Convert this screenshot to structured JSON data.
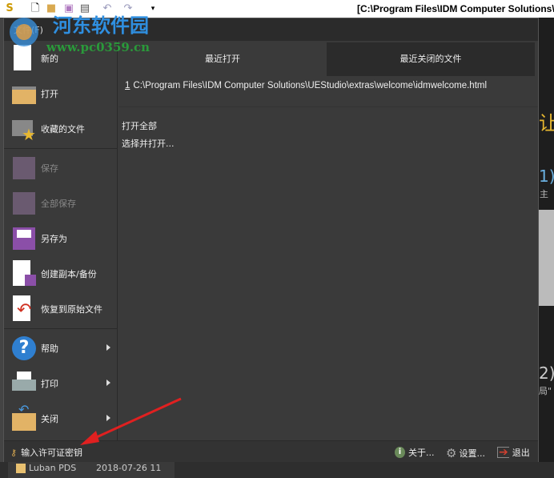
{
  "titlebar": {
    "title": "[C:\\Program Files\\IDM Computer Solutions\\U"
  },
  "menu": {
    "file_tab": "文件(F)",
    "sidebar": [
      {
        "label": "新的",
        "icon": "new-file-icon"
      },
      {
        "label": "打开",
        "icon": "open-folder-icon"
      },
      {
        "label": "收藏的文件",
        "icon": "favorites-icon"
      },
      {
        "label": "保存",
        "icon": "save-icon",
        "disabled": true
      },
      {
        "label": "全部保存",
        "icon": "save-all-icon",
        "disabled": true
      },
      {
        "label": "另存为",
        "icon": "save-as-icon"
      },
      {
        "label": "创建副本/备份",
        "icon": "backup-icon"
      },
      {
        "label": "恢复到原始文件",
        "icon": "revert-icon"
      },
      {
        "label": "帮助",
        "icon": "help-icon"
      },
      {
        "label": "打印",
        "icon": "print-icon"
      },
      {
        "label": "关闭",
        "icon": "close-folder-icon"
      }
    ],
    "tabs": [
      "最近打开",
      "最近关闭的文件"
    ],
    "recent_files": [
      {
        "num": "1",
        "path": "C:\\Program Files\\IDM Computer Solutions\\UEStudio\\extras\\welcome\\idmwelcome.html"
      }
    ],
    "open_all": "打开全部",
    "select_open": "选择并打开...",
    "bottom": {
      "license": "输入许可证密钥",
      "about": "关于...",
      "settings": "设置...",
      "exit": "退出"
    }
  },
  "editor": {
    "line1": "让",
    "line2": "1)",
    "line3": "\"主",
    "line4": "2)",
    "line5": "局\""
  },
  "filelist": {
    "name": "Luban PDS",
    "date": "2018-07-26 11"
  },
  "watermark": {
    "text": "河东软件园",
    "url": "www.pc0359.cn"
  }
}
